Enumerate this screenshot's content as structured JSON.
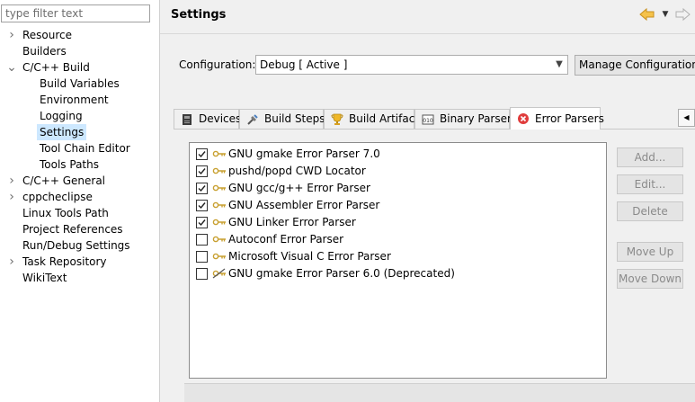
{
  "filter": {
    "placeholder": "type filter text"
  },
  "tree": [
    {
      "label": "Resource",
      "level": 0,
      "chevron": "right"
    },
    {
      "label": "Builders",
      "level": 0,
      "chevron": ""
    },
    {
      "label": "C/C++ Build",
      "level": 0,
      "chevron": "down"
    },
    {
      "label": "Build Variables",
      "level": 1,
      "chevron": ""
    },
    {
      "label": "Environment",
      "level": 1,
      "chevron": ""
    },
    {
      "label": "Logging",
      "level": 1,
      "chevron": ""
    },
    {
      "label": "Settings",
      "level": 1,
      "chevron": "",
      "selected": true
    },
    {
      "label": "Tool Chain Editor",
      "level": 1,
      "chevron": ""
    },
    {
      "label": "Tools Paths",
      "level": 1,
      "chevron": ""
    },
    {
      "label": "C/C++ General",
      "level": 0,
      "chevron": "right"
    },
    {
      "label": "cppcheclipse",
      "level": 0,
      "chevron": "right"
    },
    {
      "label": "Linux Tools Path",
      "level": 0,
      "chevron": ""
    },
    {
      "label": "Project References",
      "level": 0,
      "chevron": ""
    },
    {
      "label": "Run/Debug Settings",
      "level": 0,
      "chevron": ""
    },
    {
      "label": "Task Repository",
      "level": 0,
      "chevron": "right"
    },
    {
      "label": "WikiText",
      "level": 0,
      "chevron": ""
    }
  ],
  "header": {
    "title": "Settings",
    "back_icon": "back-arrow-icon",
    "menu_icon": "view-menu-icon",
    "forward_icon": "forward-arrow-icon"
  },
  "configuration": {
    "label": "Configuration:",
    "value": "Debug  [ Active ]",
    "manage_label": "Manage Configurations..."
  },
  "tabs": [
    {
      "label": "Devices",
      "icon": "devices-icon"
    },
    {
      "label": "Build Steps",
      "icon": "build-steps-icon"
    },
    {
      "label": "Build Artifact",
      "icon": "trophy-icon"
    },
    {
      "label": "Binary Parsers",
      "icon": "binary-icon"
    },
    {
      "label": "Error Parsers",
      "icon": "error-icon",
      "active": true
    }
  ],
  "tab_scroll_icon": "scroll-left-icon",
  "parsers": [
    {
      "label": "GNU gmake Error Parser 7.0",
      "checked": true
    },
    {
      "label": "pushd/popd CWD Locator",
      "checked": true
    },
    {
      "label": "GNU gcc/g++ Error Parser",
      "checked": true
    },
    {
      "label": "GNU Assembler Error Parser",
      "checked": true
    },
    {
      "label": "GNU Linker Error Parser",
      "checked": true
    },
    {
      "label": "Autoconf Error Parser",
      "checked": false
    },
    {
      "label": "Microsoft Visual C Error Parser",
      "checked": false
    },
    {
      "label": "GNU gmake Error Parser 6.0 (Deprecated)",
      "checked": false,
      "deprecated": true
    }
  ],
  "buttons": {
    "add": "Add...",
    "edit": "Edit...",
    "delete": "Delete",
    "move_up": "Move Up",
    "move_down": "Move Down"
  },
  "colors": {
    "selection": "#cde8ff",
    "nav_arrow": "#e8b030",
    "error_red": "#e03c3c",
    "key_gold": "#c8a030"
  }
}
